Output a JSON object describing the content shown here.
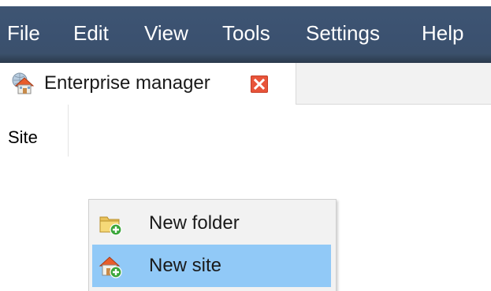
{
  "menubar": {
    "items": [
      "File",
      "Edit",
      "View",
      "Tools",
      "Settings",
      "Help"
    ]
  },
  "tab": {
    "label": "Enterprise manager",
    "icon": "enterprise-manager-icon",
    "close_icon": "close-icon",
    "close_color": "#e8543a"
  },
  "table": {
    "columns": [
      "Site"
    ]
  },
  "context_menu": {
    "items": [
      {
        "label": "New folder",
        "icon": "new-folder-icon",
        "highlighted": false
      },
      {
        "label": "New site",
        "icon": "new-site-icon",
        "highlighted": true
      }
    ],
    "highlight_color": "#91c9f7"
  },
  "colors": {
    "menubar_background": "#3b5170",
    "menubar_text": "#ffffff"
  }
}
